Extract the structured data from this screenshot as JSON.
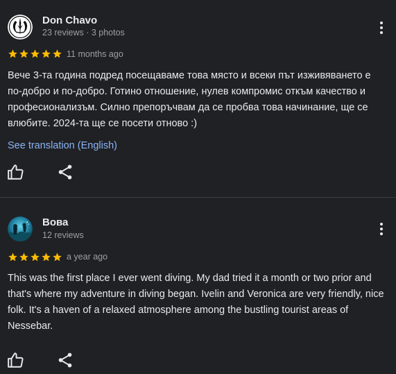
{
  "reviews": [
    {
      "author": "Don Chavo",
      "meta": "23 reviews · 3 photos",
      "rating": 5,
      "date": "11 months ago",
      "text": "Вече 3-та година подред посещаваме това място и всеки път изживяването е по-добро и по-добро. Готино отношение, нулев компромис откъм качество и професионализъм. Силно препоръчвам да се пробва това начинание, ще се влюбите. 2024-та ще се посети отново :)",
      "translate_label": "See translation (English)",
      "avatar_icon": "jedi-order-emblem-icon"
    },
    {
      "author": "Вова",
      "meta": "12 reviews",
      "rating": 5,
      "date": "a year ago",
      "text": "This was the first place I ever went diving. My dad tried it a month or two prior and that's where my adventure in diving began. Ivelin and Veronica are very friendly, nice folk. It's a haven of a relaxed atmosphere among the bustling tourist areas of Nessebar.",
      "avatar_icon": "underwater-photo-avatar"
    }
  ],
  "icons": {
    "more": "more-vert-icon",
    "like": "thumbs-up-icon",
    "share": "share-icon",
    "star": "star-icon"
  },
  "colors": {
    "background": "#202124",
    "star": "#fbbc04",
    "link": "#8ab4f8",
    "secondary_text": "#9aa0a6",
    "primary_text": "#e8eaed"
  }
}
